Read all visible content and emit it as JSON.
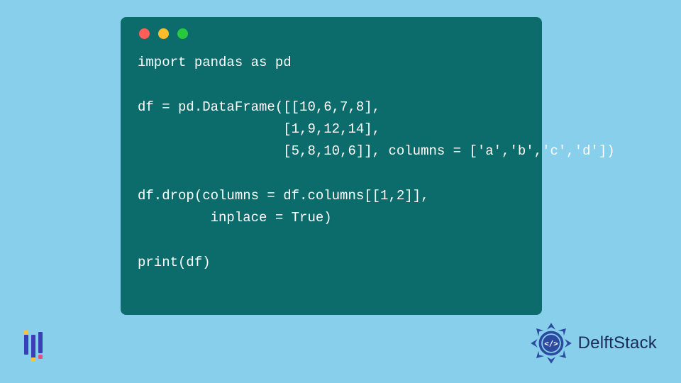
{
  "code": {
    "line1": "import pandas as pd",
    "line2": "",
    "line3": "df = pd.DataFrame([[10,6,7,8],",
    "line4": "                  [1,9,12,14],",
    "line5": "                  [5,8,10,6]], columns = ['a','b','c','d'])",
    "line6": "",
    "line7": "df.drop(columns = df.columns[[1,2]],",
    "line8": "         inplace = True)",
    "line9": "",
    "line10": "print(df)"
  },
  "brand": "DelftStack",
  "colors": {
    "bg": "#87cfeb",
    "window": "#0c6b6b",
    "brandText": "#1b2b5c"
  }
}
